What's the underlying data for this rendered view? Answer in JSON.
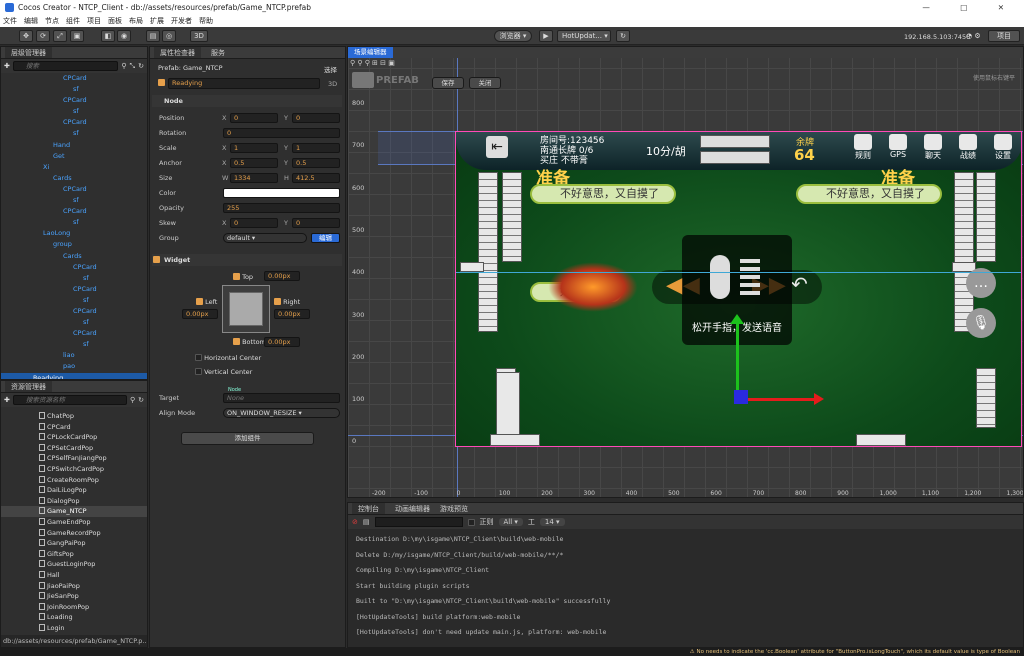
{
  "app": {
    "title": "Cocos Creator - NTCP_Client - db://assets/resources/prefab/Game_NTCP.prefab",
    "window_buttons": "—  □  ✕"
  },
  "menu": [
    "文件",
    "编辑",
    "节点",
    "组件",
    "项目",
    "面板",
    "布局",
    "扩展",
    "开发者",
    "帮助"
  ],
  "toolbar": {
    "preview_label": "浏览器 ▾",
    "scene_select": "HotUpdat... ▾",
    "ip": "192.168.5.103:7456",
    "project_btn": "项目",
    "mode_3d": "3D"
  },
  "hierarchy": {
    "tab": "层级管理器",
    "search_placeholder": "搜索",
    "items": [
      {
        "label": "CPCard",
        "depth": 6
      },
      {
        "label": "sf",
        "depth": 7
      },
      {
        "label": "CPCard",
        "depth": 6
      },
      {
        "label": "sf",
        "depth": 7
      },
      {
        "label": "CPCard",
        "depth": 6
      },
      {
        "label": "sf",
        "depth": 7
      },
      {
        "label": "Hand",
        "depth": 5
      },
      {
        "label": "Get",
        "depth": 5
      },
      {
        "label": "Xi",
        "depth": 4
      },
      {
        "label": "Cards",
        "depth": 5
      },
      {
        "label": "CPCard",
        "depth": 6
      },
      {
        "label": "sf",
        "depth": 7
      },
      {
        "label": "CPCard",
        "depth": 6
      },
      {
        "label": "sf",
        "depth": 7
      },
      {
        "label": "LaoLong",
        "depth": 4
      },
      {
        "label": "group",
        "depth": 5
      },
      {
        "label": "Cards",
        "depth": 6
      },
      {
        "label": "CPCard",
        "depth": 7
      },
      {
        "label": "sf",
        "depth": 8
      },
      {
        "label": "CPCard",
        "depth": 7
      },
      {
        "label": "sf",
        "depth": 8
      },
      {
        "label": "CPCard",
        "depth": 7
      },
      {
        "label": "sf",
        "depth": 8
      },
      {
        "label": "CPCard",
        "depth": 7
      },
      {
        "label": "sf",
        "depth": 8
      },
      {
        "label": "liao",
        "depth": 6
      },
      {
        "label": "pao",
        "depth": 6
      },
      {
        "label": "Readying",
        "depth": 3
      }
    ]
  },
  "assets": {
    "tab": "资源管理器",
    "search_placeholder": "搜索资源名称",
    "path": "db://assets/resources/prefab/Game_NTCP.p...",
    "items": [
      "ChatPop",
      "CPCard",
      "CPLockCardPop",
      "CPSetCardPop",
      "CPSelfFanJiangPop",
      "CPSwitchCardPop",
      "CreateRoomPop",
      "DaiLiLogPop",
      "DialogPop",
      "Game_NTCP",
      "GameEndPop",
      "GameRecordPop",
      "GangPaiPop",
      "GiftsPop",
      "GuestLoginPop",
      "Hall",
      "JiaoPaiPop",
      "JieSanPop",
      "JoinRoomPop",
      "Loading",
      "Login"
    ],
    "selected": "Game_NTCP"
  },
  "inspector": {
    "tab": "属性检查器",
    "tab2": "服务",
    "prefab_label": "Prefab: Game_NTCP",
    "select_btn": "选择",
    "node_name": "Readying",
    "node_3d": "3D",
    "node_section": "Node",
    "position": {
      "label": "Position",
      "x": "0",
      "y": "0"
    },
    "rotation": {
      "label": "Rotation",
      "v": "0"
    },
    "scale": {
      "label": "Scale",
      "x": "1",
      "y": "1"
    },
    "anchor": {
      "label": "Anchor",
      "x": "0.5",
      "y": "0.5"
    },
    "size": {
      "label": "Size",
      "w": "1334",
      "h": "412.5"
    },
    "color": {
      "label": "Color",
      "value": "#ffffff"
    },
    "opacity": {
      "label": "Opacity",
      "v": "255"
    },
    "skew": {
      "label": "Skew",
      "x": "0",
      "y": "0"
    },
    "group": {
      "label": "Group",
      "v": "default ▾",
      "edit": "编辑"
    },
    "widget": {
      "section": "Widget",
      "top": "Top",
      "top_v": "0.00px",
      "left": "Left",
      "left_v": "0.00px",
      "right": "Right",
      "right_v": "0.00px",
      "bottom": "Bottom",
      "bottom_v": "0.00px",
      "hcenter": "Horizontal Center",
      "vcenter": "Vertical Center",
      "target": "Target",
      "target_tag": "Node",
      "target_v": "None",
      "align": "Align Mode",
      "align_v": "ON_WINDOW_RESIZE ▾"
    },
    "add_component": "添加组件"
  },
  "scene": {
    "tab": "场景编辑器",
    "prefab_title": "PREFAB",
    "save": "保存",
    "close": "关闭",
    "hint": "使用鼠标右键平",
    "yticks": [
      "800",
      "700",
      "600",
      "500",
      "400",
      "300",
      "200",
      "100",
      "0"
    ],
    "xticks": [
      "-200",
      "-100",
      "0",
      "100",
      "200",
      "300",
      "400",
      "500",
      "600",
      "700",
      "800",
      "900",
      "1,000",
      "1,100",
      "1,200",
      "1,300"
    ]
  },
  "game": {
    "room": "房间号:123456",
    "rule1": "南通长牌 0/6",
    "rule2": "买庄 不带膏",
    "score": "10分/胡",
    "left_label": "余牌",
    "left_count": "64",
    "btns": [
      "规则",
      "GPS",
      "聊天",
      "战绩",
      "设置"
    ],
    "ready": "准备",
    "bubble1": "不好意思，又自摸了",
    "bubble2": "不好意思，又自摸了",
    "bubble3": "好意思",
    "voice_text": "松开手指，发送语音"
  },
  "console": {
    "tabs": [
      "控制台",
      "动画编辑器",
      "游戏预览"
    ],
    "regex": "正则",
    "level": "All ▾",
    "font": "14 ▾",
    "lines": [
      "Destination D:\\my\\isgame\\NTCP_Client\\build\\web-mobile",
      "Delete D:/my/isgame/NTCP_Client/build/web-mobile/**/*",
      "Compiling D:\\my\\isgame\\NTCP_Client",
      "Start building plugin scripts",
      "Built to \"D:\\my\\isgame\\NTCP_Client\\build\\web-mobile\" successfully",
      "[HotUpdateTools] build platform:web-mobile",
      "[HotUpdateTools] don't need update main.js, platform: web-mobile"
    ]
  },
  "status": "⚠ No needs to indicate the 'cc.Boolean' attribute for \"ButtonPro.isLongTouch\", which its default value is type of Boolean"
}
